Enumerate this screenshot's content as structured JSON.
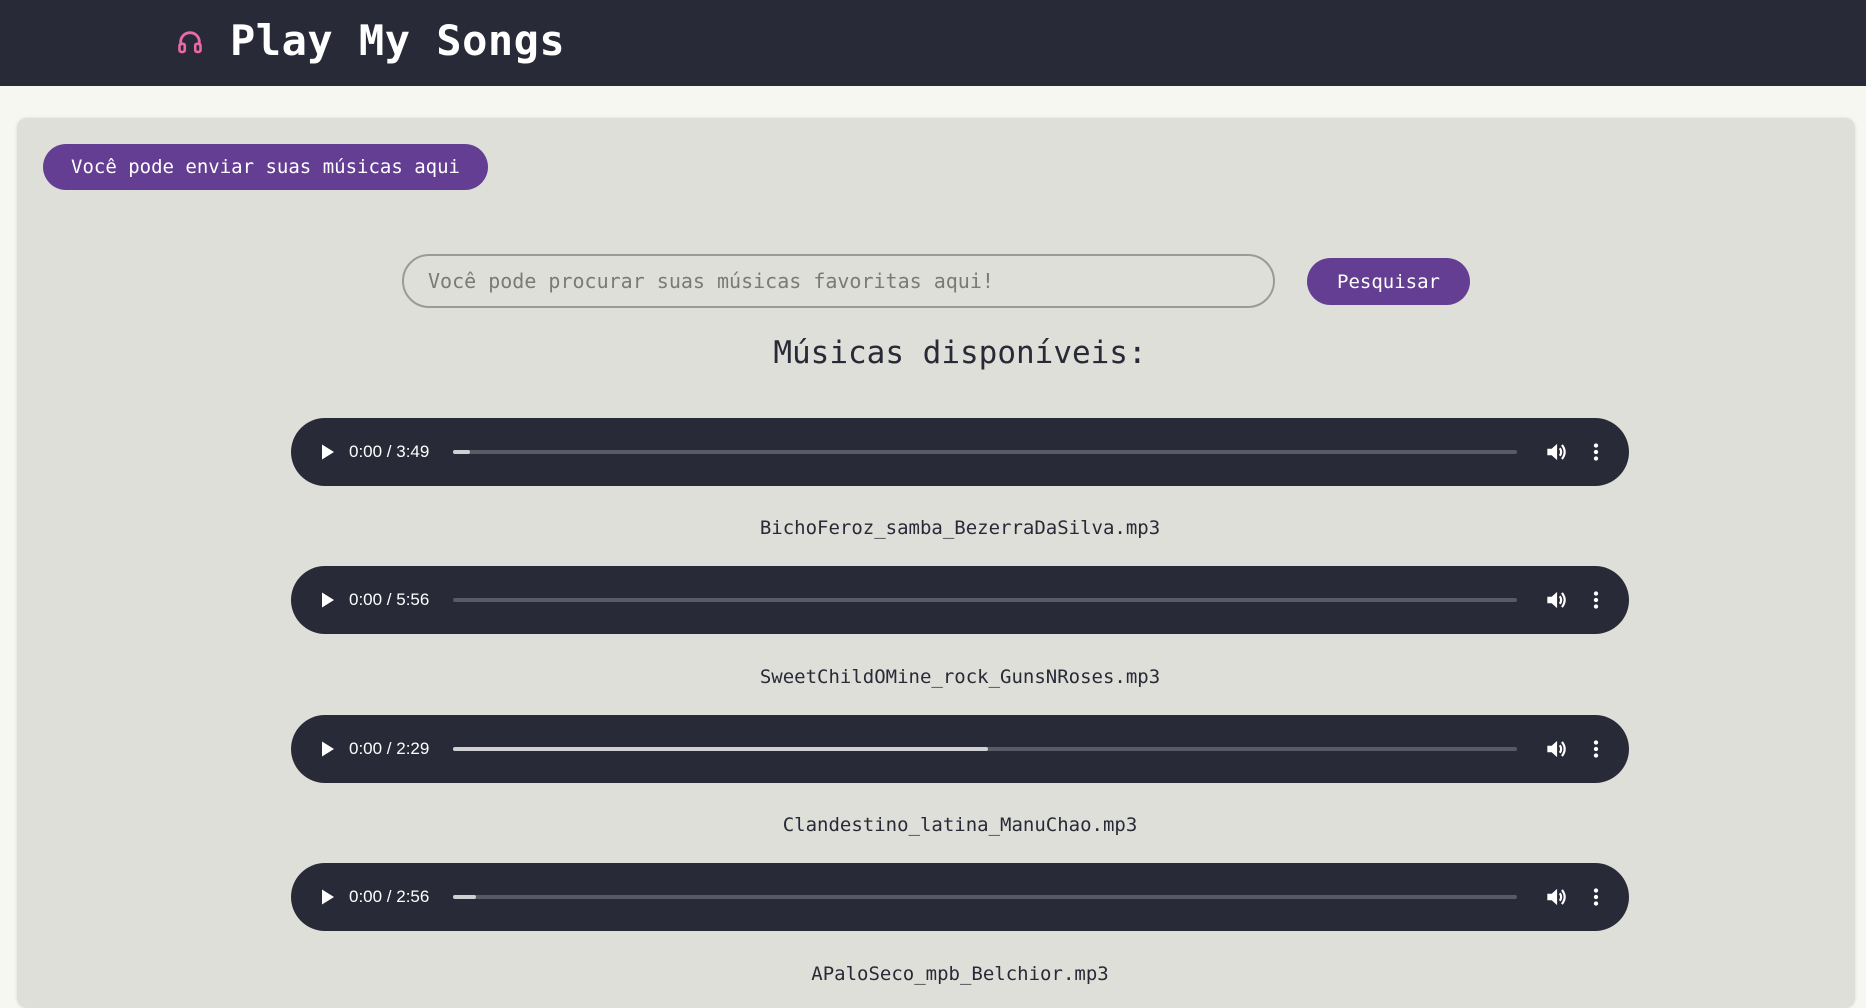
{
  "header": {
    "title": "Play My Songs",
    "icon": "headphones-icon",
    "background": "#282a37",
    "icon_color": "#e86aa8"
  },
  "upload_button": {
    "label": "Você pode enviar suas músicas aqui"
  },
  "search": {
    "placeholder": "Você pode procurar suas músicas favoritas aqui!",
    "value": "",
    "button_label": "Pesquisar"
  },
  "section_title": "Músicas disponíveis:",
  "accent_color": "#643e92",
  "songs": [
    {
      "time": "0:00 / 3:49",
      "filename": "BichoFeroz_samba_BezerraDaSilva.mp3",
      "buffered": 0.016
    },
    {
      "time": "0:00 / 5:56",
      "filename": "SweetChildOMine_rock_GunsNRoses.mp3",
      "buffered": 0
    },
    {
      "time": "0:00 / 2:29",
      "filename": "Clandestino_latina_ManuChao.mp3",
      "buffered": 0.503
    },
    {
      "time": "0:00 / 2:56",
      "filename": "APaloSeco_mpb_Belchior.mp3",
      "buffered": 0.022
    }
  ]
}
